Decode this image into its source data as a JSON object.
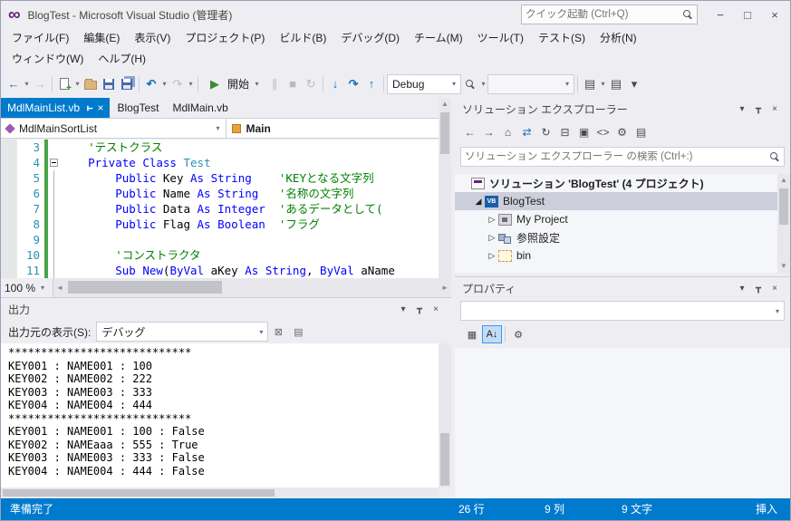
{
  "titlebar": {
    "title": "BlogTest - Microsoft Visual Studio (管理者)",
    "quick_launch_placeholder": "クイック起動 (Ctrl+Q)"
  },
  "menu": {
    "row1": [
      "ファイル(F)",
      "編集(E)",
      "表示(V)",
      "プロジェクト(P)",
      "ビルド(B)",
      "デバッグ(D)",
      "チーム(M)",
      "ツール(T)",
      "テスト(S)",
      "分析(N)"
    ],
    "row2": [
      "ウィンドウ(W)",
      "ヘルプ(H)"
    ]
  },
  "toolbar": {
    "start_label": "開始",
    "config_value": "Debug"
  },
  "editor": {
    "tabs": [
      {
        "label": "MdlMainList.vb",
        "active": true
      },
      {
        "label": "BlogTest",
        "active": false
      },
      {
        "label": "MdlMain.vb",
        "active": false
      }
    ],
    "nav_type": "MdlMainSortList",
    "nav_member": "Main",
    "zoom": "100 %",
    "code_lines": [
      {
        "num": "3",
        "outline": "",
        "segments": [
          [
            "pl",
            "    "
          ],
          [
            "cm",
            "'テストクラス"
          ]
        ]
      },
      {
        "num": "4",
        "outline": "box",
        "segments": [
          [
            "pl",
            "    "
          ],
          [
            "kw",
            "Private"
          ],
          [
            "pl",
            " "
          ],
          [
            "kw",
            "Class"
          ],
          [
            "pl",
            " "
          ],
          [
            "ty",
            "Test"
          ]
        ]
      },
      {
        "num": "5",
        "outline": "line",
        "segments": [
          [
            "pl",
            "        "
          ],
          [
            "kw",
            "Public"
          ],
          [
            "pl",
            " Key "
          ],
          [
            "kw",
            "As"
          ],
          [
            "pl",
            " "
          ],
          [
            "kw",
            "String"
          ],
          [
            "pl",
            "    "
          ],
          [
            "cm",
            "'KEYとなる文字列"
          ]
        ]
      },
      {
        "num": "6",
        "outline": "line",
        "segments": [
          [
            "pl",
            "        "
          ],
          [
            "kw",
            "Public"
          ],
          [
            "pl",
            " Name "
          ],
          [
            "kw",
            "As"
          ],
          [
            "pl",
            " "
          ],
          [
            "kw",
            "String"
          ],
          [
            "pl",
            "   "
          ],
          [
            "cm",
            "'名称の文字列"
          ]
        ]
      },
      {
        "num": "7",
        "outline": "line",
        "segments": [
          [
            "pl",
            "        "
          ],
          [
            "kw",
            "Public"
          ],
          [
            "pl",
            " Data "
          ],
          [
            "kw",
            "As"
          ],
          [
            "pl",
            " "
          ],
          [
            "kw",
            "Integer"
          ],
          [
            "pl",
            "  "
          ],
          [
            "cm",
            "'あるデータとして("
          ]
        ]
      },
      {
        "num": "8",
        "outline": "line",
        "segments": [
          [
            "pl",
            "        "
          ],
          [
            "kw",
            "Public"
          ],
          [
            "pl",
            " Flag "
          ],
          [
            "kw",
            "As"
          ],
          [
            "pl",
            " "
          ],
          [
            "kw",
            "Boolean"
          ],
          [
            "pl",
            "  "
          ],
          [
            "cm",
            "'フラグ"
          ]
        ]
      },
      {
        "num": "9",
        "outline": "line",
        "segments": []
      },
      {
        "num": "10",
        "outline": "line",
        "segments": [
          [
            "pl",
            "        "
          ],
          [
            "cm",
            "'コンストラクタ"
          ]
        ]
      },
      {
        "num": "11",
        "outline": "line",
        "segments": [
          [
            "pl",
            "        "
          ],
          [
            "kw",
            "Sub"
          ],
          [
            "pl",
            " "
          ],
          [
            "kw",
            "New"
          ],
          [
            "pl",
            "("
          ],
          [
            "kw",
            "ByVal"
          ],
          [
            "pl",
            " aKey "
          ],
          [
            "kw",
            "As"
          ],
          [
            "pl",
            " "
          ],
          [
            "kw",
            "String"
          ],
          [
            "pl",
            ", "
          ],
          [
            "kw",
            "ByVal"
          ],
          [
            "pl",
            " aName"
          ]
        ]
      }
    ]
  },
  "output": {
    "title": "出力",
    "source_label": "出力元の表示(S):",
    "source_value": "デバッグ",
    "lines": [
      "****************************",
      "KEY001 : NAME001 : 100",
      "KEY002 : NAME002 : 222",
      "KEY003 : NAME003 : 333",
      "KEY004 : NAME004 : 444",
      "****************************",
      "KEY001 : NAME001 : 100 : False",
      "KEY002 : NAMEaaa : 555 : True",
      "KEY003 : NAME003 : 333 : False",
      "KEY004 : NAME004 : 444 : False"
    ]
  },
  "solution_explorer": {
    "title": "ソリューション エクスプローラー",
    "search_placeholder": "ソリューション エクスプローラー の検索 (Ctrl+:)",
    "tree": [
      {
        "label": "ソリューション 'BlogTest' (4 プロジェクト)",
        "icon": "solution",
        "indent": 0,
        "arrow": "",
        "selected": false,
        "bold": true
      },
      {
        "label": "BlogTest",
        "icon": "vb-project",
        "indent": 1,
        "arrow": "expanded",
        "selected": true,
        "bold": false
      },
      {
        "label": "My Project",
        "icon": "my-project",
        "indent": 2,
        "arrow": "collapsed",
        "selected": false,
        "bold": false
      },
      {
        "label": "参照設定",
        "icon": "references",
        "indent": 2,
        "arrow": "collapsed",
        "selected": false,
        "bold": false
      },
      {
        "label": "bin",
        "icon": "folder",
        "indent": 2,
        "arrow": "collapsed",
        "selected": false,
        "bold": false
      }
    ]
  },
  "properties": {
    "title": "プロパティ"
  },
  "statusbar": {
    "ready": "準備完了",
    "line": "26 行",
    "column": "9 列",
    "character": "9 文字",
    "mode": "挿入"
  },
  "icons": {
    "logo": "∞",
    "minimize": "−",
    "maximize": "□",
    "close": "×",
    "back": "←",
    "forward": "→",
    "dropdown": "▾",
    "undo": "↶",
    "redo": "↷",
    "play": "▶",
    "pause": "∥",
    "stop": "■",
    "restart": "↻",
    "step-into": "↓",
    "step-over": "↷",
    "step-out": "↑",
    "home": "⌂",
    "sync": "⇄",
    "refresh": "↻",
    "collapse-all": "⊟",
    "properties": "▤",
    "code-view": "<>",
    "wrench": "⚙",
    "preview": "▣",
    "pin": "┳",
    "clear": "⊠",
    "layers": "▤",
    "categorized": "▦",
    "alphabetical": "A↓",
    "expanded-arrow": "◢",
    "collapsed-arrow": "▷",
    "scroll-up": "▲",
    "scroll-down": "▼",
    "scroll-left": "◄",
    "scroll-right": "►"
  }
}
